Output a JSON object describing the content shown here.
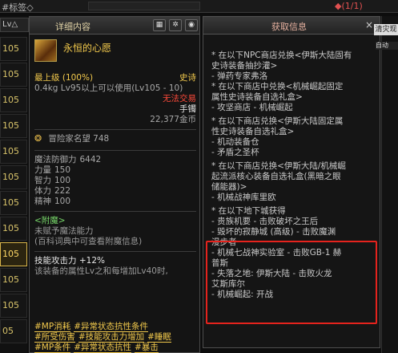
{
  "top_bar": {
    "tag_text": "#标签◇",
    "right_text": "◆(1/1)"
  },
  "level_list": {
    "header": "Lv△",
    "items": [
      "105",
      "105",
      "105",
      "105",
      "105",
      "105",
      "105",
      "105",
      "105",
      "105",
      "105",
      "05"
    ],
    "selected_index": 8
  },
  "detail_panel": {
    "title": "详细内容",
    "icons": [
      "grid-icon",
      "gear-icon",
      "eye-icon"
    ],
    "item": {
      "name": "永恒的心愿",
      "grade": "最上级",
      "grade_pct": "(100%)",
      "rarity": "史诗",
      "weight_req": "0.4kg  Lv95以上可以使用(Lv105 - 10)",
      "trade": "无法交易",
      "slot": "手镯",
      "price": "22,377金币",
      "fame": "冒险家名望 748",
      "stats": [
        {
          "label": "魔法防御力",
          "value": "6442"
        },
        {
          "label": "力量",
          "value": "150"
        },
        {
          "label": "智力",
          "value": "100"
        },
        {
          "label": "体力",
          "value": "222"
        },
        {
          "label": "精神",
          "value": "100"
        }
      ],
      "enchant_title": "<附魔>",
      "enchant_lines": [
        "未赋予魔法能力",
        "(百科词典中可查看附魔信息)"
      ],
      "skill_attack_label": "技能攻击力",
      "skill_attack_value": "+12%",
      "skill_desc": "该装备的属性Lv之和每增加Lv40时,",
      "tags": [
        [
          "#MP消耗",
          "#异常状态抗性条件"
        ],
        [
          "#所受伤害",
          "#技能攻击力增加",
          "#睡眠"
        ],
        [
          "#MP条件",
          "#异常状态抗性",
          "#暴击"
        ]
      ]
    }
  },
  "source_panel": {
    "title": "获取信息",
    "close": "×",
    "lines": [
      "* 在以下NPC商店兑换<伊斯大陆固有",
      "史诗装备抽抄灌>",
      "- 弹药专家弗洛",
      "* 在以下商店中兑换<机械崛起固定",
      "属性史诗装备自选礼盒>",
      "- 攻坚商店 - 机械崛起",
      "",
      "* 在以下商店兑换<伊斯大陆固定属",
      "性史诗装备自选礼盒>",
      "- 机动装备仓",
      "- 矛盾之圣杯",
      "",
      "* 在以下商店兑换<伊斯大陆/机械崛",
      "起流派核心装备自选礼盒(黑暗之眼",
      "储能器)>",
      "- 机械战神库里欧",
      "",
      "* 在以下地下城获得",
      "- 贵族机要 - 击败破坏之王后",
      "- 毁坏的寂静城 (高级) - 击败魔渊",
      "漫步者",
      "- 机械七战神实验室 - 击败GB-1 赫",
      "普斯",
      "- 失落之地: 伊斯大陆 - 击败火龙",
      "艾斯库尔",
      "- 机械崛起: 开战"
    ]
  },
  "right_edge": {
    "badge": "清灾现",
    "badge2": "自动"
  },
  "colors": {
    "gold": "#f2c94c",
    "red": "#ff4a3a",
    "green": "#78d86a",
    "highlight": "#e5231d"
  }
}
